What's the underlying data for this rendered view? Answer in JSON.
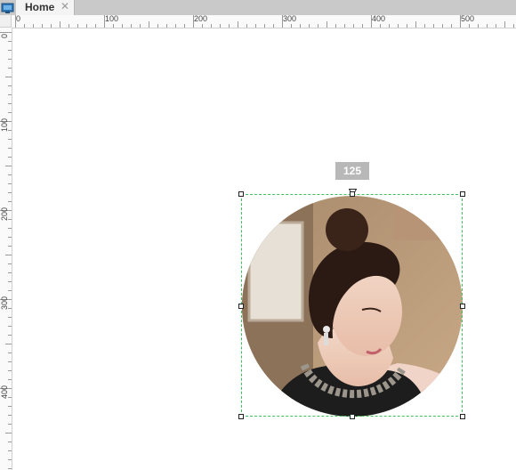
{
  "tabs": [
    {
      "label": "Home",
      "close_glyph": "✕"
    }
  ],
  "ruler": {
    "h_labels": [
      "0",
      "100",
      "200",
      "300",
      "400",
      "500"
    ],
    "v_labels": [
      "0",
      "100",
      "200",
      "300",
      "400"
    ]
  },
  "selection": {
    "rotation_label": "125"
  },
  "colors": {
    "selection_outline": "#3fbf5f",
    "badge": "#b8b8b8"
  }
}
